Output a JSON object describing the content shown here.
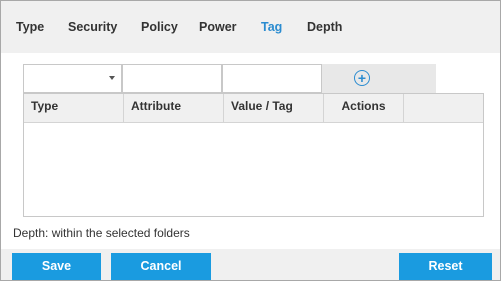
{
  "tabs": [
    {
      "label": "Type",
      "active": false
    },
    {
      "label": "Security",
      "active": false
    },
    {
      "label": "Policy",
      "active": false
    },
    {
      "label": "Power",
      "active": false
    },
    {
      "label": "Tag",
      "active": true
    },
    {
      "label": "Depth",
      "active": false
    }
  ],
  "filter": {
    "type_select_value": "",
    "attribute_value": "",
    "value_tag_value": "",
    "add_icon": "plus-circle-icon"
  },
  "table": {
    "columns": [
      "Type",
      "Attribute",
      "Value / Tag",
      "Actions"
    ],
    "rows": []
  },
  "depth_note": "Depth: within the selected folders",
  "buttons": {
    "save": "Save",
    "cancel": "Cancel",
    "reset": "Reset"
  },
  "colors": {
    "accent": "#2b8cd0",
    "button": "#1a9be0",
    "panel": "#f0f0f0"
  }
}
